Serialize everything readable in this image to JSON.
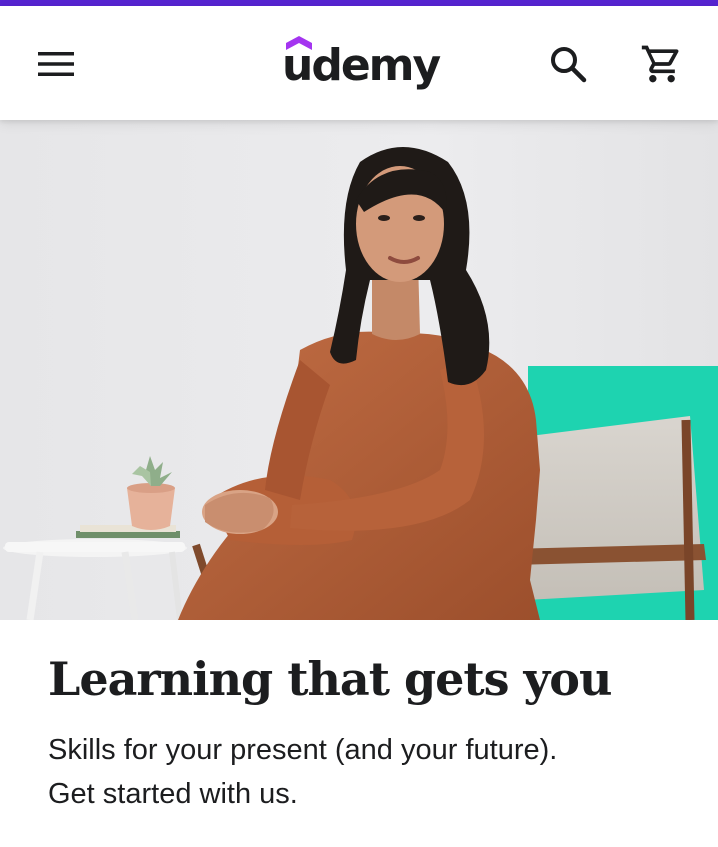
{
  "header": {
    "logo_text": "udemy",
    "menu_icon": "hamburger-menu-icon",
    "search_icon": "search-icon",
    "cart_icon": "shopping-cart-icon"
  },
  "hero": {
    "image_description_icon": "hero-photo"
  },
  "main": {
    "headline": "Learning that gets you",
    "subline_1": "Skills for your present (and your future).",
    "subline_2": "Get started with us."
  },
  "colors": {
    "brand_purple": "#5624d0",
    "text_dark": "#1c1d1f",
    "accent_teal": "#1ed3b0",
    "dress_rust": "#b8643c"
  }
}
